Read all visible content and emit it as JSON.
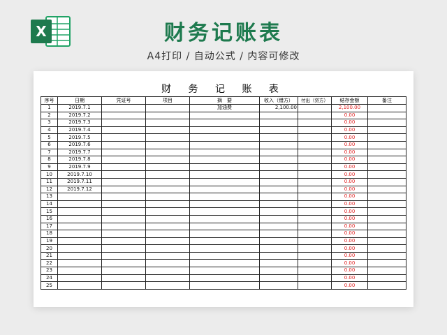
{
  "header": {
    "title": "财务记账表",
    "subtitle": "A4打印 / 自动公式 / 内容可修改",
    "logo_icon": "excel-icon",
    "brand_color": "#1e7a4e"
  },
  "sheet": {
    "title": "财 务 记 账 表",
    "columns": [
      "序号",
      "日期",
      "凭证号",
      "项目",
      "摘　要",
      "收入（借方）",
      "付出（贷方）",
      "结存金额",
      "备注"
    ],
    "rows": [
      {
        "idx": "1",
        "date": "2019.7.1",
        "voucher": "",
        "item": "",
        "summary": "加油费",
        "income": "2,100.00",
        "expense": "",
        "balance": "2,100.00",
        "note": ""
      },
      {
        "idx": "2",
        "date": "2019.7.2",
        "voucher": "",
        "item": "",
        "summary": "",
        "income": "",
        "expense": "",
        "balance": "0.00",
        "note": ""
      },
      {
        "idx": "3",
        "date": "2019.7.3",
        "voucher": "",
        "item": "",
        "summary": "",
        "income": "",
        "expense": "",
        "balance": "0.00",
        "note": ""
      },
      {
        "idx": "4",
        "date": "2019.7.4",
        "voucher": "",
        "item": "",
        "summary": "",
        "income": "",
        "expense": "",
        "balance": "0.00",
        "note": ""
      },
      {
        "idx": "5",
        "date": "2019.7.5",
        "voucher": "",
        "item": "",
        "summary": "",
        "income": "",
        "expense": "",
        "balance": "0.00",
        "note": ""
      },
      {
        "idx": "6",
        "date": "2019.7.6",
        "voucher": "",
        "item": "",
        "summary": "",
        "income": "",
        "expense": "",
        "balance": "0.00",
        "note": ""
      },
      {
        "idx": "7",
        "date": "2019.7.7",
        "voucher": "",
        "item": "",
        "summary": "",
        "income": "",
        "expense": "",
        "balance": "0.00",
        "note": ""
      },
      {
        "idx": "8",
        "date": "2019.7.8",
        "voucher": "",
        "item": "",
        "summary": "",
        "income": "",
        "expense": "",
        "balance": "0.00",
        "note": ""
      },
      {
        "idx": "9",
        "date": "2019.7.9",
        "voucher": "",
        "item": "",
        "summary": "",
        "income": "",
        "expense": "",
        "balance": "0.00",
        "note": ""
      },
      {
        "idx": "10",
        "date": "2019.7.10",
        "voucher": "",
        "item": "",
        "summary": "",
        "income": "",
        "expense": "",
        "balance": "0.00",
        "note": ""
      },
      {
        "idx": "11",
        "date": "2019.7.11",
        "voucher": "",
        "item": "",
        "summary": "",
        "income": "",
        "expense": "",
        "balance": "0.00",
        "note": ""
      },
      {
        "idx": "12",
        "date": "2019.7.12",
        "voucher": "",
        "item": "",
        "summary": "",
        "income": "",
        "expense": "",
        "balance": "0.00",
        "note": ""
      },
      {
        "idx": "13",
        "date": "",
        "voucher": "",
        "item": "",
        "summary": "",
        "income": "",
        "expense": "",
        "balance": "0.00",
        "note": ""
      },
      {
        "idx": "14",
        "date": "",
        "voucher": "",
        "item": "",
        "summary": "",
        "income": "",
        "expense": "",
        "balance": "0.00",
        "note": ""
      },
      {
        "idx": "15",
        "date": "",
        "voucher": "",
        "item": "",
        "summary": "",
        "income": "",
        "expense": "",
        "balance": "0.00",
        "note": ""
      },
      {
        "idx": "16",
        "date": "",
        "voucher": "",
        "item": "",
        "summary": "",
        "income": "",
        "expense": "",
        "balance": "0.00",
        "note": ""
      },
      {
        "idx": "17",
        "date": "",
        "voucher": "",
        "item": "",
        "summary": "",
        "income": "",
        "expense": "",
        "balance": "0.00",
        "note": ""
      },
      {
        "idx": "18",
        "date": "",
        "voucher": "",
        "item": "",
        "summary": "",
        "income": "",
        "expense": "",
        "balance": "0.00",
        "note": ""
      },
      {
        "idx": "19",
        "date": "",
        "voucher": "",
        "item": "",
        "summary": "",
        "income": "",
        "expense": "",
        "balance": "0.00",
        "note": ""
      },
      {
        "idx": "20",
        "date": "",
        "voucher": "",
        "item": "",
        "summary": "",
        "income": "",
        "expense": "",
        "balance": "0.00",
        "note": ""
      },
      {
        "idx": "21",
        "date": "",
        "voucher": "",
        "item": "",
        "summary": "",
        "income": "",
        "expense": "",
        "balance": "0.00",
        "note": ""
      },
      {
        "idx": "22",
        "date": "",
        "voucher": "",
        "item": "",
        "summary": "",
        "income": "",
        "expense": "",
        "balance": "0.00",
        "note": ""
      },
      {
        "idx": "23",
        "date": "",
        "voucher": "",
        "item": "",
        "summary": "",
        "income": "",
        "expense": "",
        "balance": "0.00",
        "note": ""
      },
      {
        "idx": "24",
        "date": "",
        "voucher": "",
        "item": "",
        "summary": "",
        "income": "",
        "expense": "",
        "balance": "0.00",
        "note": ""
      },
      {
        "idx": "25",
        "date": "",
        "voucher": "",
        "item": "",
        "summary": "",
        "income": "",
        "expense": "",
        "balance": "0.00",
        "note": ""
      }
    ],
    "balance_color": "#e02020"
  }
}
